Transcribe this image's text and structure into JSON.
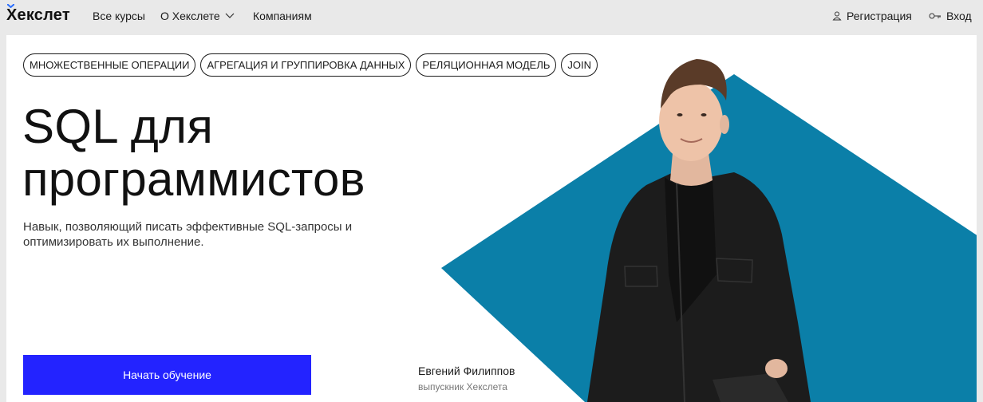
{
  "header": {
    "logo_text": "Хекслет",
    "nav": [
      {
        "label": "Все курсы"
      },
      {
        "label": "О Хекслете"
      },
      {
        "label": "Компаниям"
      }
    ],
    "register_label": "Регистрация",
    "login_label": "Вход"
  },
  "hero": {
    "tags": [
      "МНОЖЕСТВЕННЫЕ ОПЕРАЦИИ",
      "АГРЕГАЦИЯ И ГРУППИРОВКА ДАННЫХ",
      "РЕЛЯЦИОННАЯ МОДЕЛЬ",
      "JOIN"
    ],
    "title_line1": "SQL для",
    "title_line2": "программистов",
    "subtitle": "Навык, позволяющий писать эффективные SQL-запросы и оптимизировать их выполнение.",
    "cta_label": "Начать обучение",
    "person_name": "Евгений Филиппов",
    "person_role": "выпускник Хекслета"
  },
  "colors": {
    "accent_blue": "#2323ff",
    "diamond_teal": "#0b7fa8",
    "page_bg": "#e9e9e9"
  }
}
